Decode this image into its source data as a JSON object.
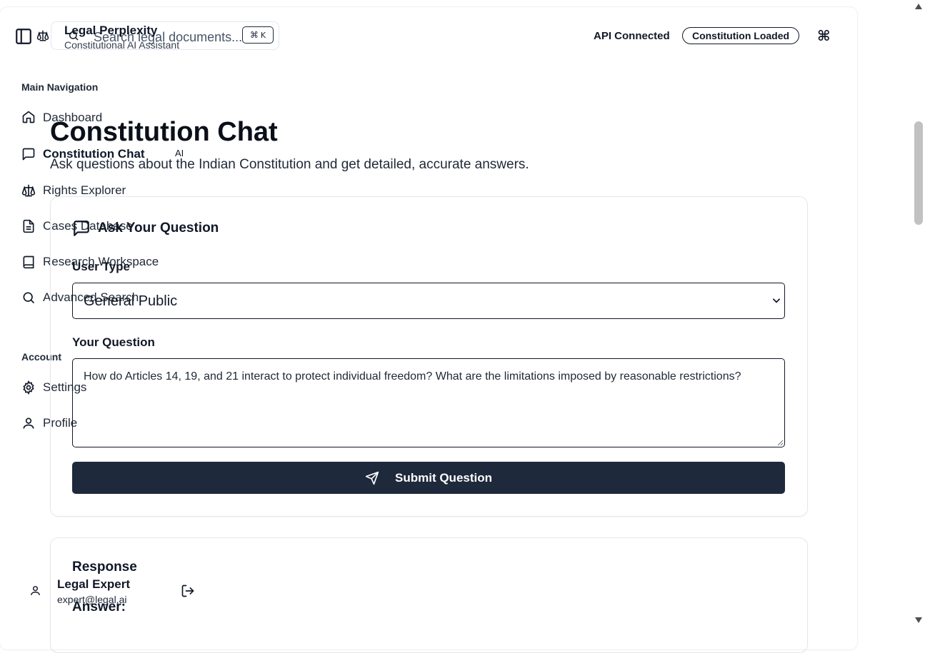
{
  "header": {
    "app_title": "Legal Perplexity",
    "app_subtitle": "Constitutional AI Assistant",
    "search_placeholder": "Search legal documents...",
    "shortcut_symbol": "⌘",
    "shortcut_key": "K",
    "api_status": "API Connected",
    "constitution_badge": "Constitution Loaded",
    "command_symbol": "⌘"
  },
  "sidebar": {
    "main_heading": "Main Navigation",
    "items": [
      {
        "label": "Dashboard",
        "icon": "home-icon"
      },
      {
        "label": "Constitution Chat",
        "icon": "message-square-icon",
        "active": true,
        "tag": "AI"
      },
      {
        "label": "Rights Explorer",
        "icon": "scale-icon"
      },
      {
        "label": "Cases Database",
        "icon": "file-text-icon"
      },
      {
        "label": "Research Workspace",
        "icon": "book-icon"
      },
      {
        "label": "Advanced Search",
        "icon": "search-icon"
      }
    ],
    "account_heading": "Account",
    "account_items": [
      {
        "label": "Settings",
        "icon": "gear-icon"
      },
      {
        "label": "Profile",
        "icon": "user-icon"
      }
    ]
  },
  "user": {
    "name": "Legal Expert",
    "email": "expert@legal.ai"
  },
  "main": {
    "title": "Constitution Chat",
    "subtitle": "Ask questions about the Indian Constitution and get detailed, accurate answers.",
    "ask_card": {
      "title": "Ask Your Question",
      "user_type_label": "User Type",
      "user_type_value": "General Public",
      "question_label": "Your Question",
      "question_value": "How do Articles 14, 19, and 21 interact to protect individual freedom? What are the limitations imposed by reasonable restrictions?",
      "submit_label": "Submit Question"
    },
    "response_card": {
      "title": "Response",
      "answer_label": "Answer:"
    }
  },
  "colors": {
    "primary_button": "#1e293b",
    "text": "#111827",
    "border": "#e5e7eb"
  }
}
